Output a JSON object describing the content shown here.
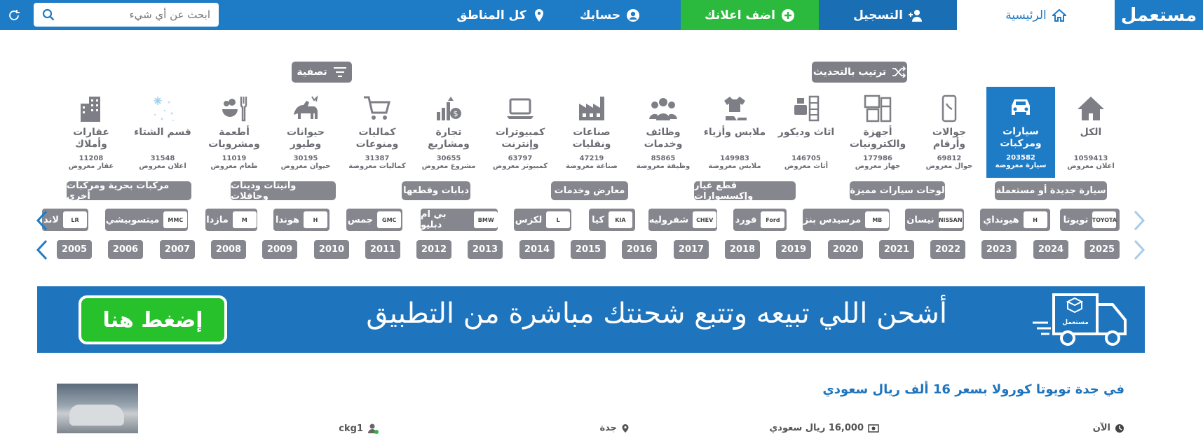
{
  "topbar": {
    "logo": "مستعمل",
    "home": "الرئيسية",
    "register": "التسجيل",
    "add_ad": "اضف اعلانك",
    "account": "حسابك",
    "regions": "كل المناطق",
    "search_placeholder": "ابحث عن أي شيء"
  },
  "controls": {
    "sort": "ترتيب بالتحديث",
    "filter": "تصفية"
  },
  "categories": [
    {
      "name": "الكل",
      "count": "1059413",
      "unit": "اعلان معروض",
      "icon": "home-icon"
    },
    {
      "name": "سيارات ومركبات",
      "count": "203582",
      "unit": "سيارة معروضة",
      "icon": "car-icon"
    },
    {
      "name": "جوالات وأرقام",
      "count": "69812",
      "unit": "جوال معروض",
      "icon": "phone-icon"
    },
    {
      "name": "أجهزة والكترونيات",
      "count": "177986",
      "unit": "جهاز معروض",
      "icon": "appliances-icon"
    },
    {
      "name": "اثاث وديكور",
      "count": "146705",
      "unit": "أثاث معروض",
      "icon": "furniture-icon"
    },
    {
      "name": "ملابس وأزياء",
      "count": "149983",
      "unit": "ملابس معروضة",
      "icon": "clothes-icon"
    },
    {
      "name": "وظائف وخدمات",
      "count": "85865",
      "unit": "وظيفة معروضة",
      "icon": "people-icon"
    },
    {
      "name": "صناعات ونقليات",
      "count": "47219",
      "unit": "صناعة معروضة",
      "icon": "factory-icon"
    },
    {
      "name": "كمبيوترات وإنترنت",
      "count": "63797",
      "unit": "كمبيوتر معروض",
      "icon": "laptop-icon"
    },
    {
      "name": "تجارة ومشاريع",
      "count": "30655",
      "unit": "مشروع معروض",
      "icon": "business-icon"
    },
    {
      "name": "كماليات ومنوعات",
      "count": "31387",
      "unit": "كماليات معروضة",
      "icon": "cart-icon"
    },
    {
      "name": "حيوانات وطيور",
      "count": "30195",
      "unit": "حيوان معروض",
      "icon": "animals-icon"
    },
    {
      "name": "أطعمة ومشروبات",
      "count": "11019",
      "unit": "طعام معروض",
      "icon": "food-icon"
    },
    {
      "name": "قسم الشتاء",
      "count": "31548",
      "unit": "اعلان معروض",
      "icon": "snow-icon"
    },
    {
      "name": "عقارات وأملاك",
      "count": "11208",
      "unit": "عقار معروض",
      "icon": "building-icon"
    }
  ],
  "subcategories": [
    "سيارة جديدة أو مستعملة",
    "لوحات سيارات مميزة",
    "قطع غيار وإكسسوارات",
    "معارض وخدمات",
    "دبابات وقطعها",
    "وانيتات ودينات وحافلات",
    "مركبات بحرية ومركبات أخرى"
  ],
  "brands": [
    {
      "name": "تويوتا",
      "logo": "TOYOTA"
    },
    {
      "name": "هيونداي",
      "logo": "H"
    },
    {
      "name": "نيسان",
      "logo": "NISSAN"
    },
    {
      "name": "مرسيدس بنز",
      "logo": "MB"
    },
    {
      "name": "فورد",
      "logo": "Ford"
    },
    {
      "name": "شفروليه",
      "logo": "CHEV"
    },
    {
      "name": "كيا",
      "logo": "KIA"
    },
    {
      "name": "لكزس",
      "logo": "L"
    },
    {
      "name": "بي ام دبليو",
      "logo": "BMW"
    },
    {
      "name": "جمس",
      "logo": "GMC"
    },
    {
      "name": "هوندا",
      "logo": "H"
    },
    {
      "name": "مازدا",
      "logo": "M"
    },
    {
      "name": "ميتسوبيشي",
      "logo": "MMC"
    },
    {
      "name": "لاند",
      "logo": "LR"
    }
  ],
  "years": [
    "2025",
    "2024",
    "2023",
    "2022",
    "2021",
    "2020",
    "2019",
    "2018",
    "2017",
    "2016",
    "2015",
    "2014",
    "2013",
    "2012",
    "2011",
    "2010",
    "2009",
    "2008",
    "2007",
    "2006",
    "2005"
  ],
  "banner": {
    "text": "أشحن اللي تبيعه وتتبع شحنتك مباشرة من التطبيق",
    "cta": "إضغط هنا",
    "truck_label": "مستعمل"
  },
  "listing": {
    "title": "في جدة تويوتا كورولا بسعر 16 ألف ريال سعودي",
    "time": "الآن",
    "price": "16,000 ريال سعودي",
    "city": "جدة",
    "user": "ckg1"
  },
  "colors": {
    "primary": "#1e7bc6",
    "green": "#2bba3e",
    "gray": "#86878e"
  }
}
